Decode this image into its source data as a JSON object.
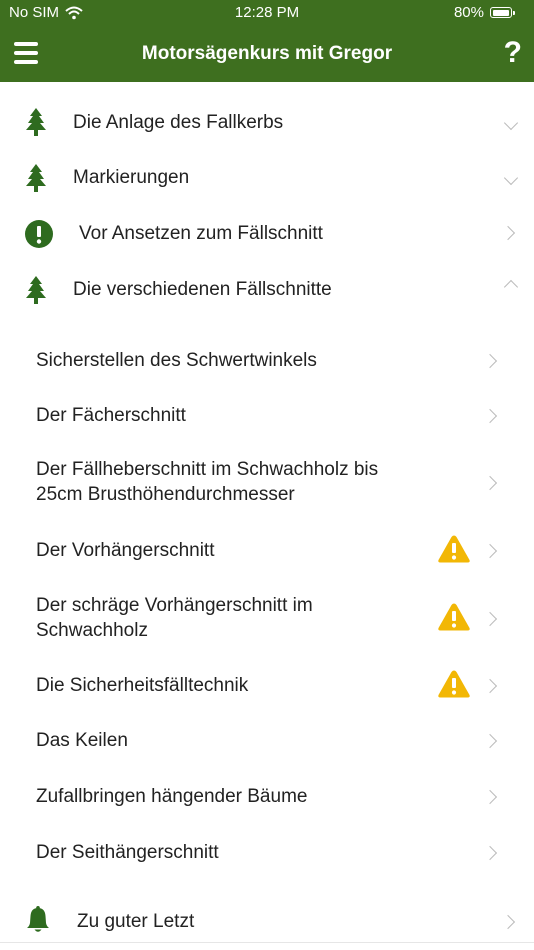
{
  "status": {
    "carrier": "No SIM",
    "time": "12:28 PM",
    "battery": "80%",
    "battery_level": 0.8
  },
  "nav": {
    "title": "Motorsägenkurs mit Gregor",
    "help": "?"
  },
  "sections": [
    {
      "label": "Die Anlage des Fallkerbs",
      "icon": "tree-icon",
      "chevron": "down"
    },
    {
      "label": "Markierungen",
      "icon": "tree-icon",
      "chevron": "down"
    },
    {
      "label": "Vor Ansetzen zum Fällschnitt",
      "icon": "exclamation-circle-icon",
      "chevron": "right"
    },
    {
      "label": "Die verschiedenen Fällschnitte",
      "icon": "tree-icon",
      "chevron": "up"
    }
  ],
  "subitems": [
    {
      "label": "Sicherstellen des Schwertwinkels",
      "warning": false
    },
    {
      "label": "Der Fächerschnitt",
      "warning": false
    },
    {
      "label_line1": "Der Fällheberschnitt im Schwachholz bis",
      "label_line2": "25cm Brusthöhendurchmesser",
      "warning": false
    },
    {
      "label": "Der Vorhängerschnitt",
      "warning": true
    },
    {
      "label_line1": "Der schräge Vorhängerschnitt im",
      "label_line2": "Schwachholz",
      "warning": true
    },
    {
      "label": "Die Sicherheitsfälltechnik",
      "warning": true
    },
    {
      "label": "Das Keilen",
      "warning": false
    },
    {
      "label": "Zufallbringen hängender Bäume",
      "warning": false
    },
    {
      "label": "Der Seithängerschnitt",
      "warning": false
    }
  ],
  "last_section": {
    "label": "Zu guter Letzt",
    "icon": "bell-icon",
    "chevron": "right"
  },
  "colors": {
    "accent": "#3e6f1f",
    "icon_green": "#2e6b1f",
    "warning": "#f2b705",
    "chevron": "#bbbbbb"
  }
}
